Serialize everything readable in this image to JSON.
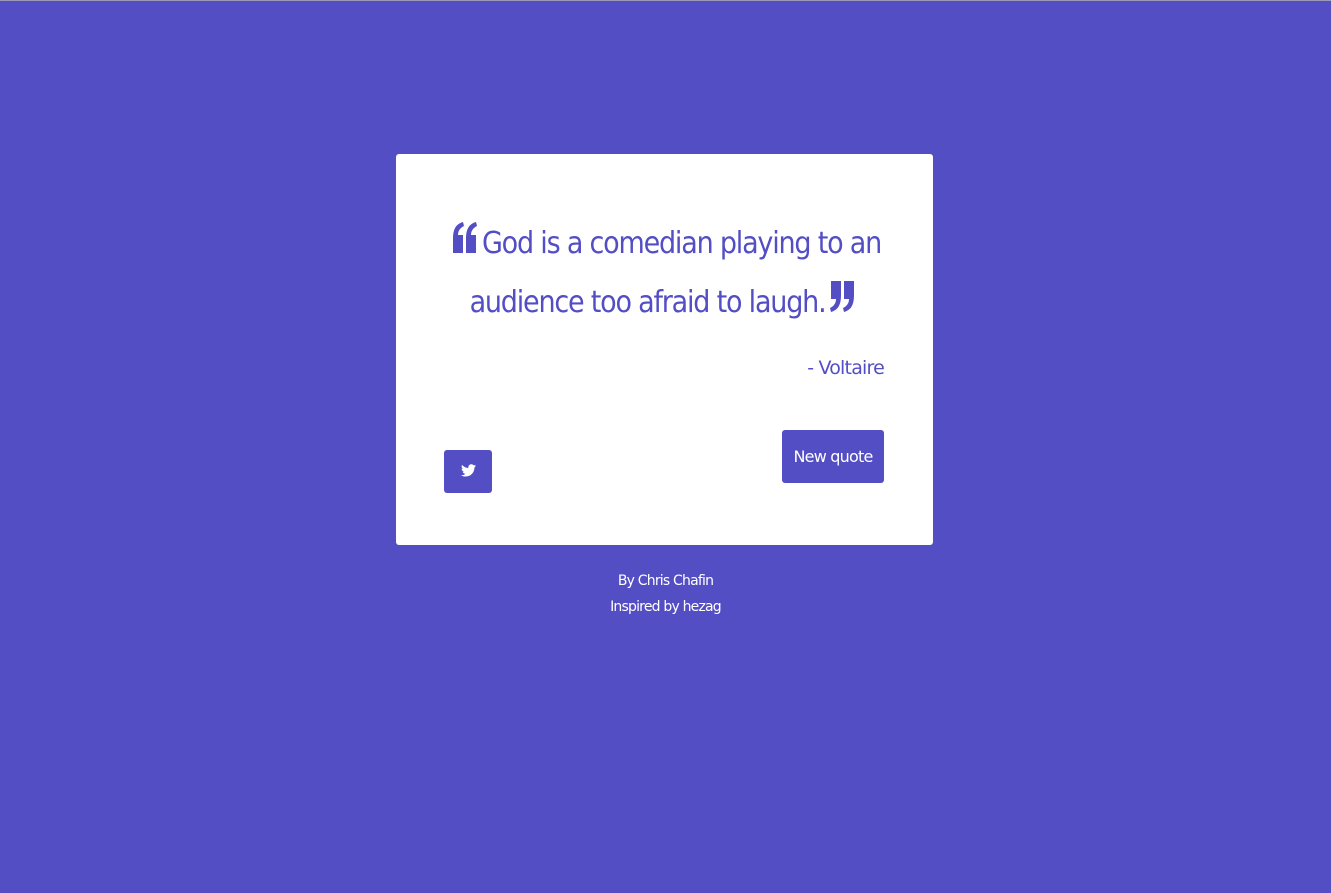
{
  "quote": {
    "text": "God is a comedian playing to an audience too afraid to laugh.",
    "author": "- Voltaire",
    "open_icon": "quote-left-icon",
    "close_icon": "quote-right-icon"
  },
  "actions": {
    "tweet_icon": "twitter-icon",
    "new_quote_label": "New quote"
  },
  "footer": {
    "by_label": "By",
    "by_name": "Chris Chafin",
    "inspired_label": "Inspired by",
    "inspired_name": "hezag"
  },
  "colors": {
    "accent": "#544ec5",
    "card": "#ffffff"
  }
}
